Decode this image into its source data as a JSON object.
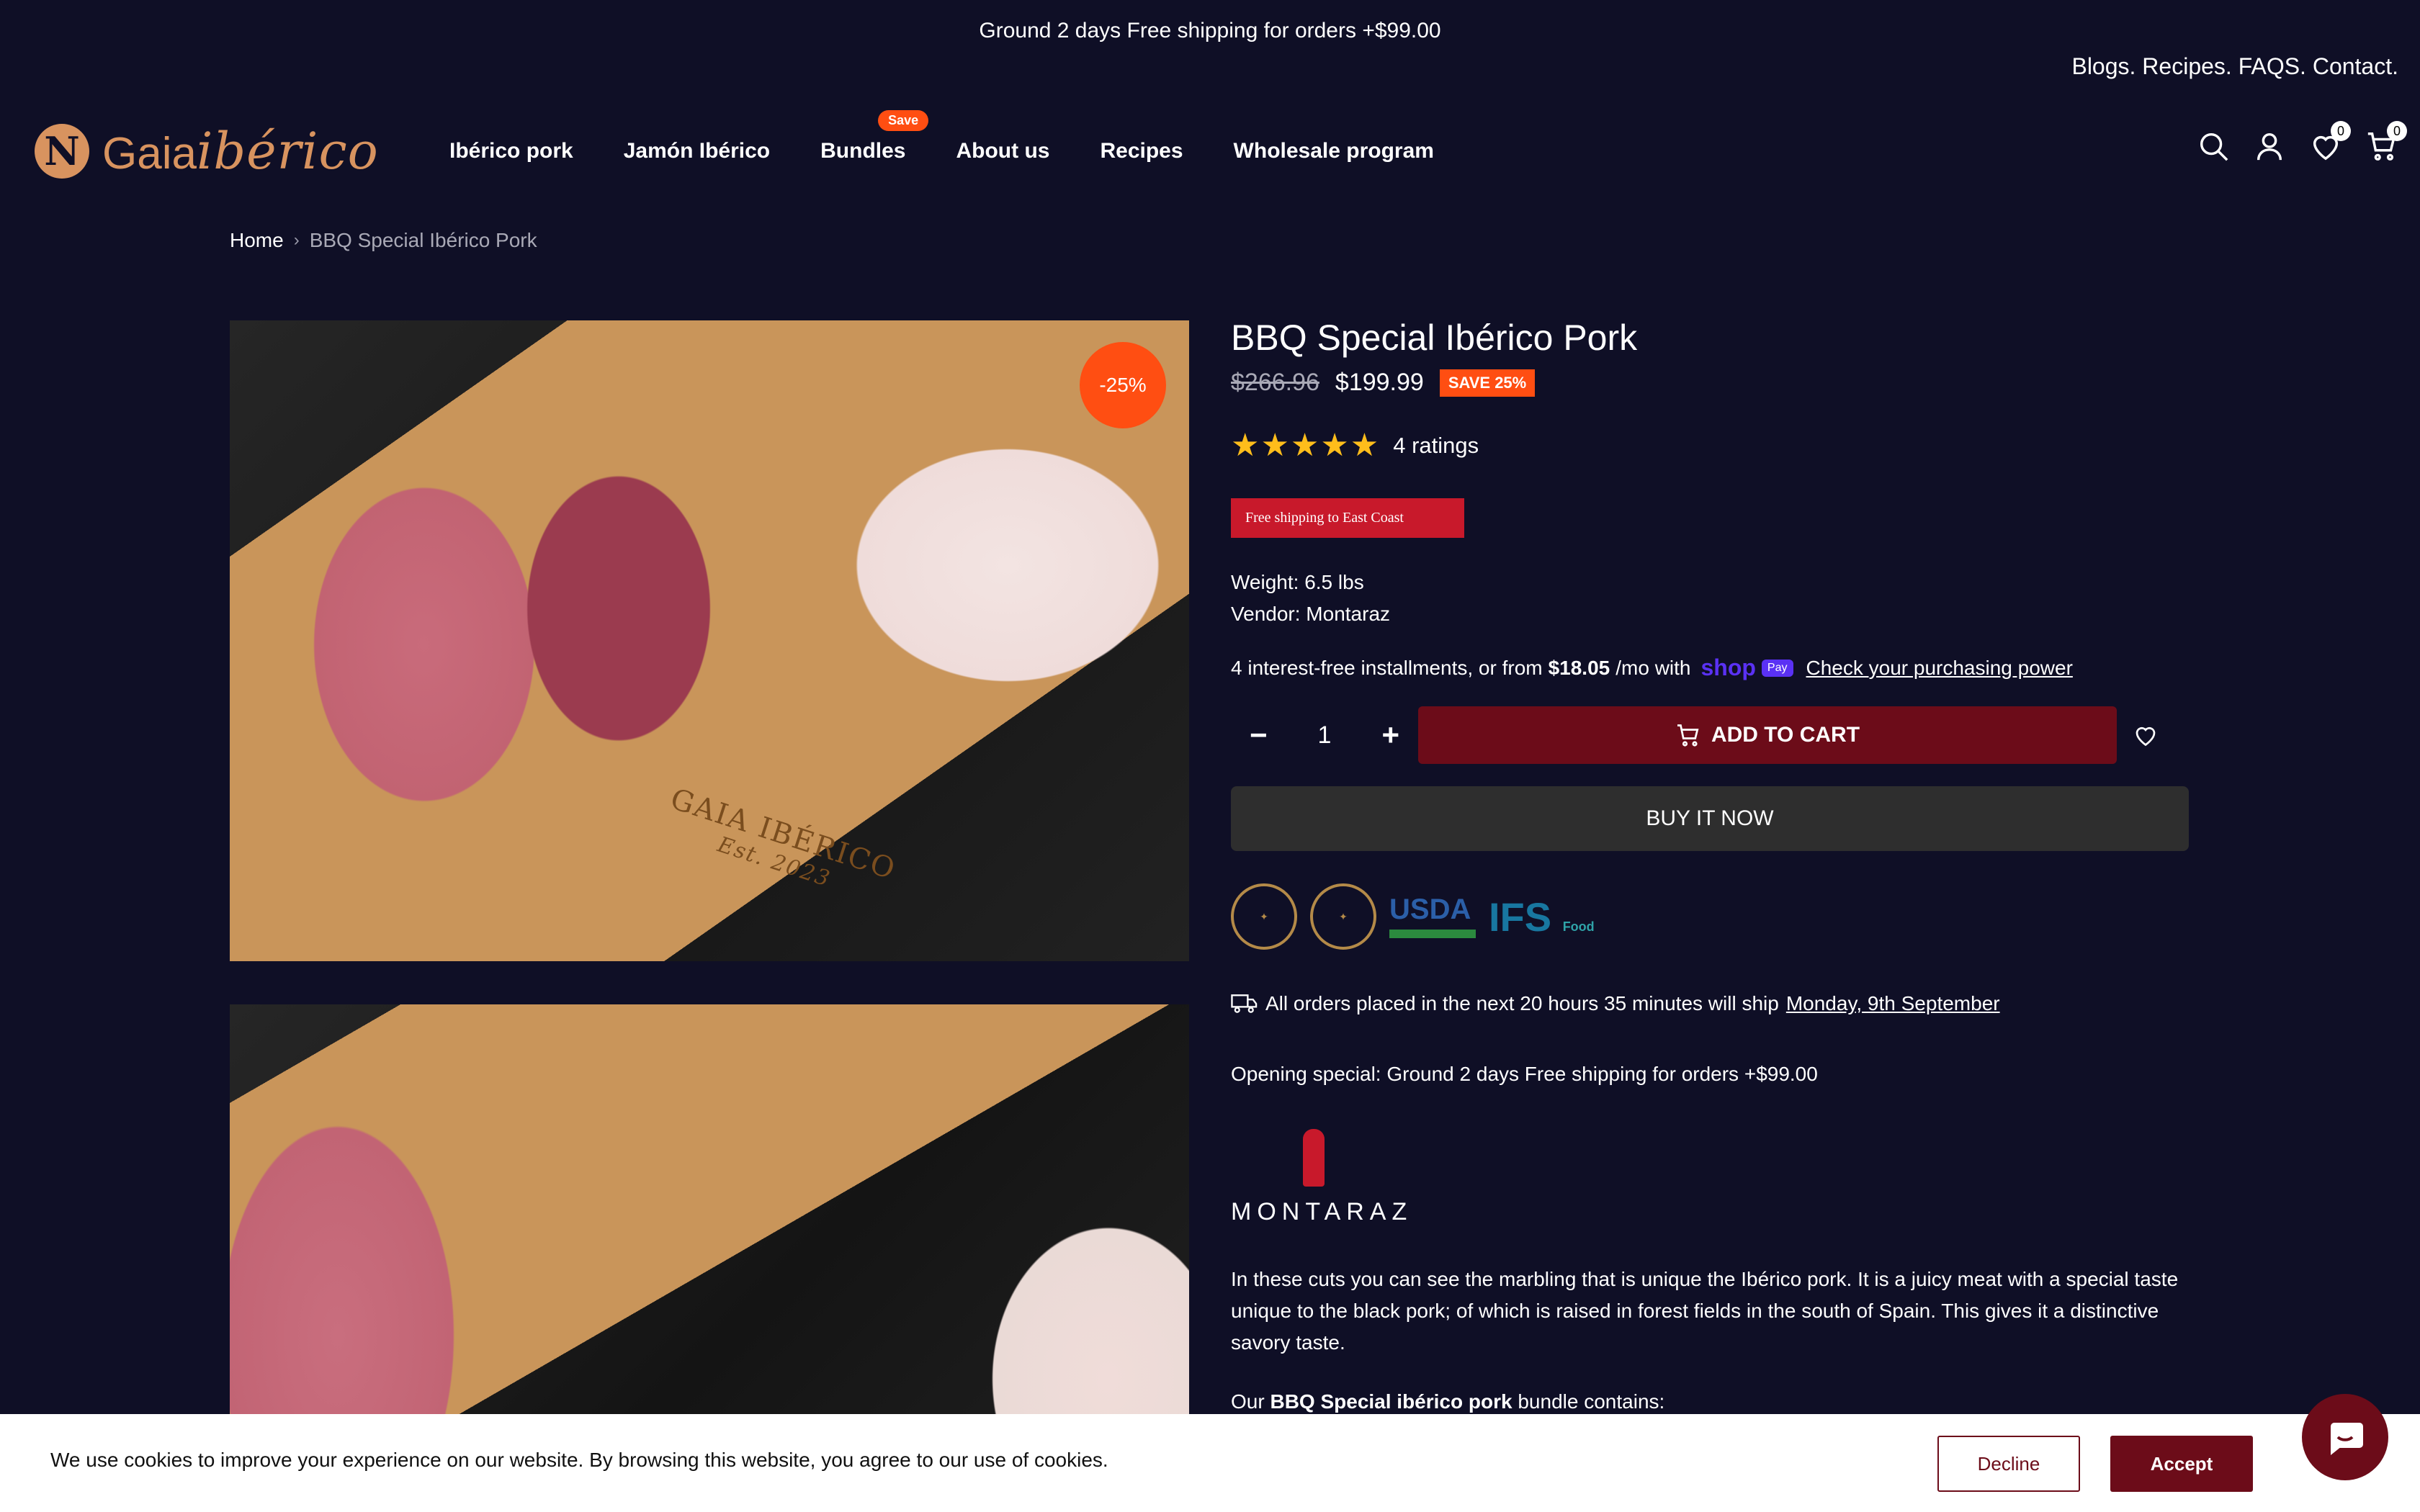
{
  "announcement": "Ground 2 days Free shipping for orders +$99.00",
  "top_links": [
    "Blogs.",
    "Recipes.",
    "FAQS.",
    "Contact."
  ],
  "brand": {
    "name_plain": "Gaia",
    "name_script": "ibérico"
  },
  "nav": [
    {
      "label": "Ibérico pork"
    },
    {
      "label": "Jamón Ibérico"
    },
    {
      "label": "Bundles",
      "badge": "Save"
    },
    {
      "label": "About us"
    },
    {
      "label": "Recipes"
    },
    {
      "label": "Wholesale program"
    }
  ],
  "header_icons": {
    "wishlist_count": "0",
    "cart_count": "0"
  },
  "breadcrumb": {
    "home": "Home",
    "separator": "›",
    "current": "BBQ Special Ibérico Pork"
  },
  "gallery": {
    "discount_badge": "-25%",
    "board_engraving_line1": "GAIA IBÉRICO",
    "board_engraving_line2": "Est. 2023"
  },
  "product": {
    "title": "BBQ Special Ibérico Pork",
    "compare_price": "$266.96",
    "price": "$199.99",
    "save_label": "SAVE 25%",
    "stars": "★★★★★",
    "ratings": "4 ratings",
    "shipping_tag": "Free shipping to East Coast",
    "weight": "Weight: 6.5 lbs",
    "vendor": "Vendor: Montaraz",
    "installments_prefix": "4 interest-free installments, or from",
    "installments_amount": "$18.05",
    "installments_suffix": "/mo with",
    "shop_word": "shop",
    "shop_pay": "Pay",
    "purchasing_power_link": "Check your purchasing power",
    "quantity": "1",
    "qty_minus": "−",
    "qty_plus": "+",
    "add_to_cart": "ADD TO CART",
    "buy_now": "BUY IT NOW",
    "badge_usda": "USDA",
    "badge_ifs": "IFS",
    "badge_ifs_sub": "Food",
    "ship_notice_prefix": "All orders placed in the next 20 hours 35 minutes will ship",
    "ship_date": "Monday, 9th September",
    "opening_special": "Opening special: Ground 2 days Free shipping for orders +$99.00",
    "vendor_logo": "MONTARAZ",
    "description": "In these cuts you can see the marbling that is unique the Ibérico pork. It is a juicy meat with a special taste unique to the black pork; of which is raised in forest fields in the south of Spain. This gives it a distinctive savory taste.",
    "contains_prefix": "Our",
    "contains_bold": "BBQ Special ibérico pork",
    "contains_suffix": "bundle contains:"
  },
  "cookie": {
    "text": "We use cookies to improve your experience on our website. By browsing this website, you agree to our use of cookies.",
    "decline": "Decline",
    "accept": "Accept"
  },
  "colors": {
    "background": "#0f0f26",
    "accent_red": "#6c0c19",
    "sale_orange": "#ff4e12",
    "star": "#ffbd1b"
  }
}
